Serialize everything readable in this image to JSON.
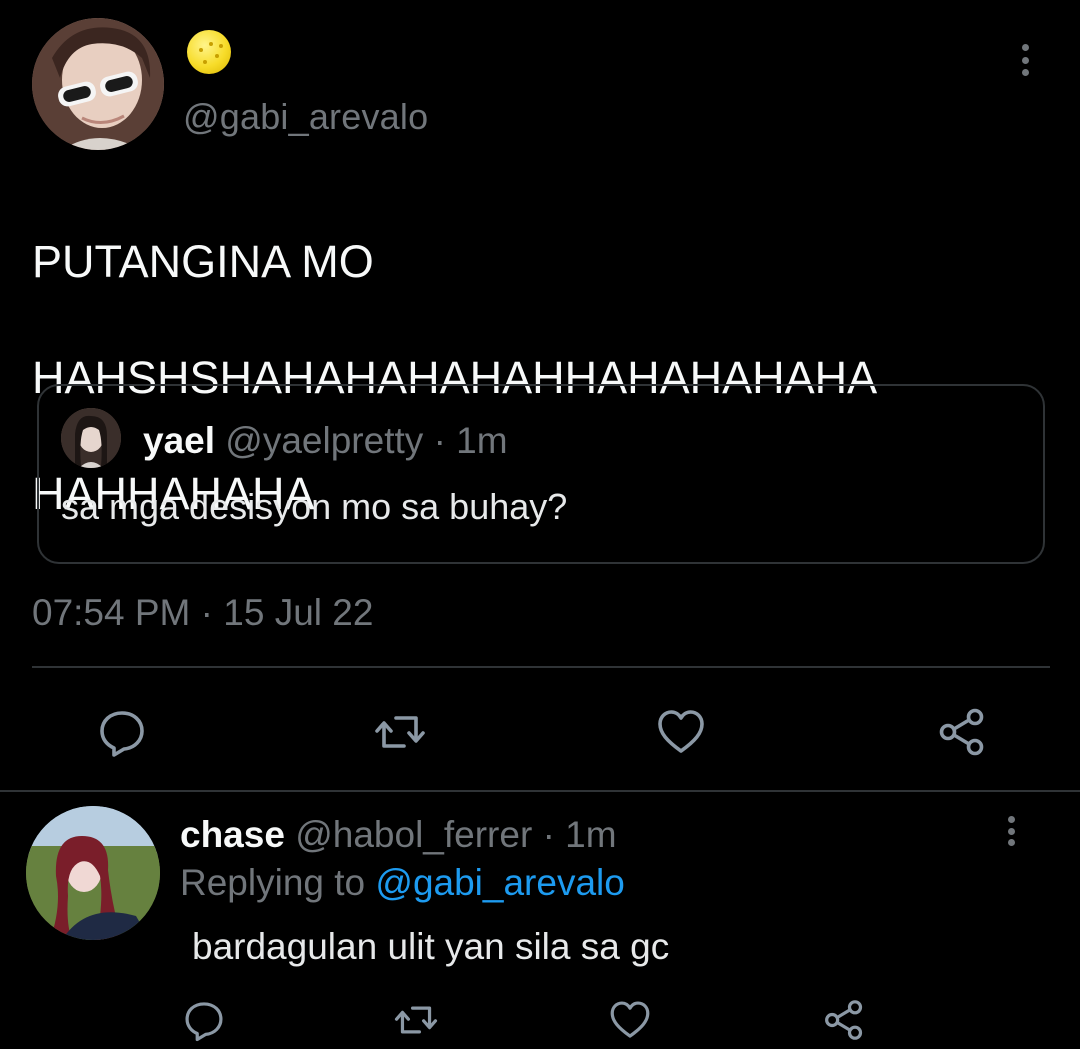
{
  "main_tweet": {
    "display_name_emoji": "yellow-round-emoji",
    "handle": "@gabi_arevalo",
    "text_lines": [
      "PUTANGINA MO",
      "HAHSHSHAHAHAHAHAHHAHAHAHAHA",
      "HAHHAHAHA"
    ],
    "quoted": {
      "name": "yael",
      "handle": "@yaelpretty",
      "separator": "·",
      "time": "1m",
      "text": "sa mga desisyon mo sa buhay?"
    },
    "timestamp": {
      "time": "07:54 PM",
      "separator": "·",
      "date": "15 Jul 22"
    },
    "actions": [
      "reply-icon",
      "retweet-icon",
      "like-icon",
      "share-icon"
    ]
  },
  "reply": {
    "name": "chase",
    "handle": "@habol_ferrer",
    "separator": "·",
    "time": "1m",
    "replying_prefix": "Replying to",
    "replying_to": "@gabi_arevalo",
    "text": "bardagulan ulit yan sila sa gc",
    "actions": [
      "reply-icon",
      "retweet-icon",
      "like-icon",
      "share-icon"
    ]
  },
  "colors": {
    "background": "#000000",
    "text_primary": "#f7f9f9",
    "text_secondary": "#71767b",
    "border": "#2f3336",
    "link": "#1d9bf0"
  }
}
